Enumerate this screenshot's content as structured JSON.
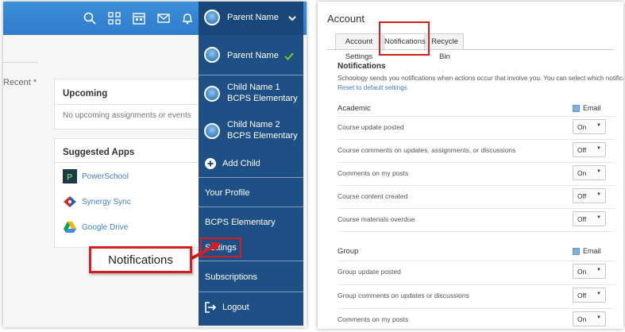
{
  "left_panel": {
    "recent_label": "Recent *",
    "upcoming": {
      "title": "Upcoming",
      "empty_text": "No upcoming assignments or events"
    },
    "suggested_apps": {
      "title": "Suggested Apps",
      "apps": [
        {
          "name": "PowerSchool",
          "icon": "powerschool-logo"
        },
        {
          "name": "Synergy Sync",
          "icon": "synergy-logo"
        },
        {
          "name": "Google Drive",
          "icon": "google-drive-logo"
        }
      ]
    },
    "callout_label": "Notifications",
    "topbar_icons": [
      "search-icon",
      "grid-icon",
      "calendar-icon",
      "mail-icon",
      "bell-icon"
    ]
  },
  "user_menu": {
    "header_name": "Parent Name",
    "accounts": [
      {
        "line1": "Parent Name",
        "line2": "",
        "selected": true
      },
      {
        "line1": "Child Name 1",
        "line2": "BCPS Elementary",
        "selected": false
      },
      {
        "line1": "Child Name 2",
        "line2": "BCPS Elementary",
        "selected": false
      }
    ],
    "add_child": "Add Child",
    "your_profile": "Your Profile",
    "school": "BCPS Elementary",
    "settings": "Settings",
    "subscriptions": "Subscriptions",
    "logout": "Logout"
  },
  "account": {
    "title": "Account",
    "tabs": [
      {
        "label": "Account Settings",
        "active": false
      },
      {
        "label": "Notifications",
        "active": true
      },
      {
        "label": "Recycle Bin",
        "active": false
      }
    ],
    "notifications_heading": "Notifications",
    "description": "Schoology sends you notifications when actions occur that involve you. You can select which notifications you would like to receive.",
    "reset_link": "Reset to default settings",
    "sections": [
      {
        "name": "Academic",
        "email_label": "Email",
        "rows": [
          {
            "label": "Course update posted",
            "value": "On"
          },
          {
            "label": "Course comments on updates, assignments, or discussions",
            "value": "Off"
          },
          {
            "label": "Comments on my posts",
            "value": "On"
          },
          {
            "label": "Course content created",
            "value": "Off"
          },
          {
            "label": "Course materials overdue",
            "value": "Off"
          }
        ]
      },
      {
        "name": "Group",
        "email_label": "Email",
        "rows": [
          {
            "label": "Group update posted",
            "value": "On"
          },
          {
            "label": "Group comments on updates or discussions",
            "value": "Off"
          },
          {
            "label": "Comments on my posts",
            "value": "On"
          }
        ]
      }
    ]
  },
  "colors": {
    "topbar": "#2f7ccb",
    "menu_bg": "#1e4f85",
    "highlight_red": "#d41e20",
    "link_blue": "#3f7fc2",
    "check_green": "#7ed321"
  }
}
